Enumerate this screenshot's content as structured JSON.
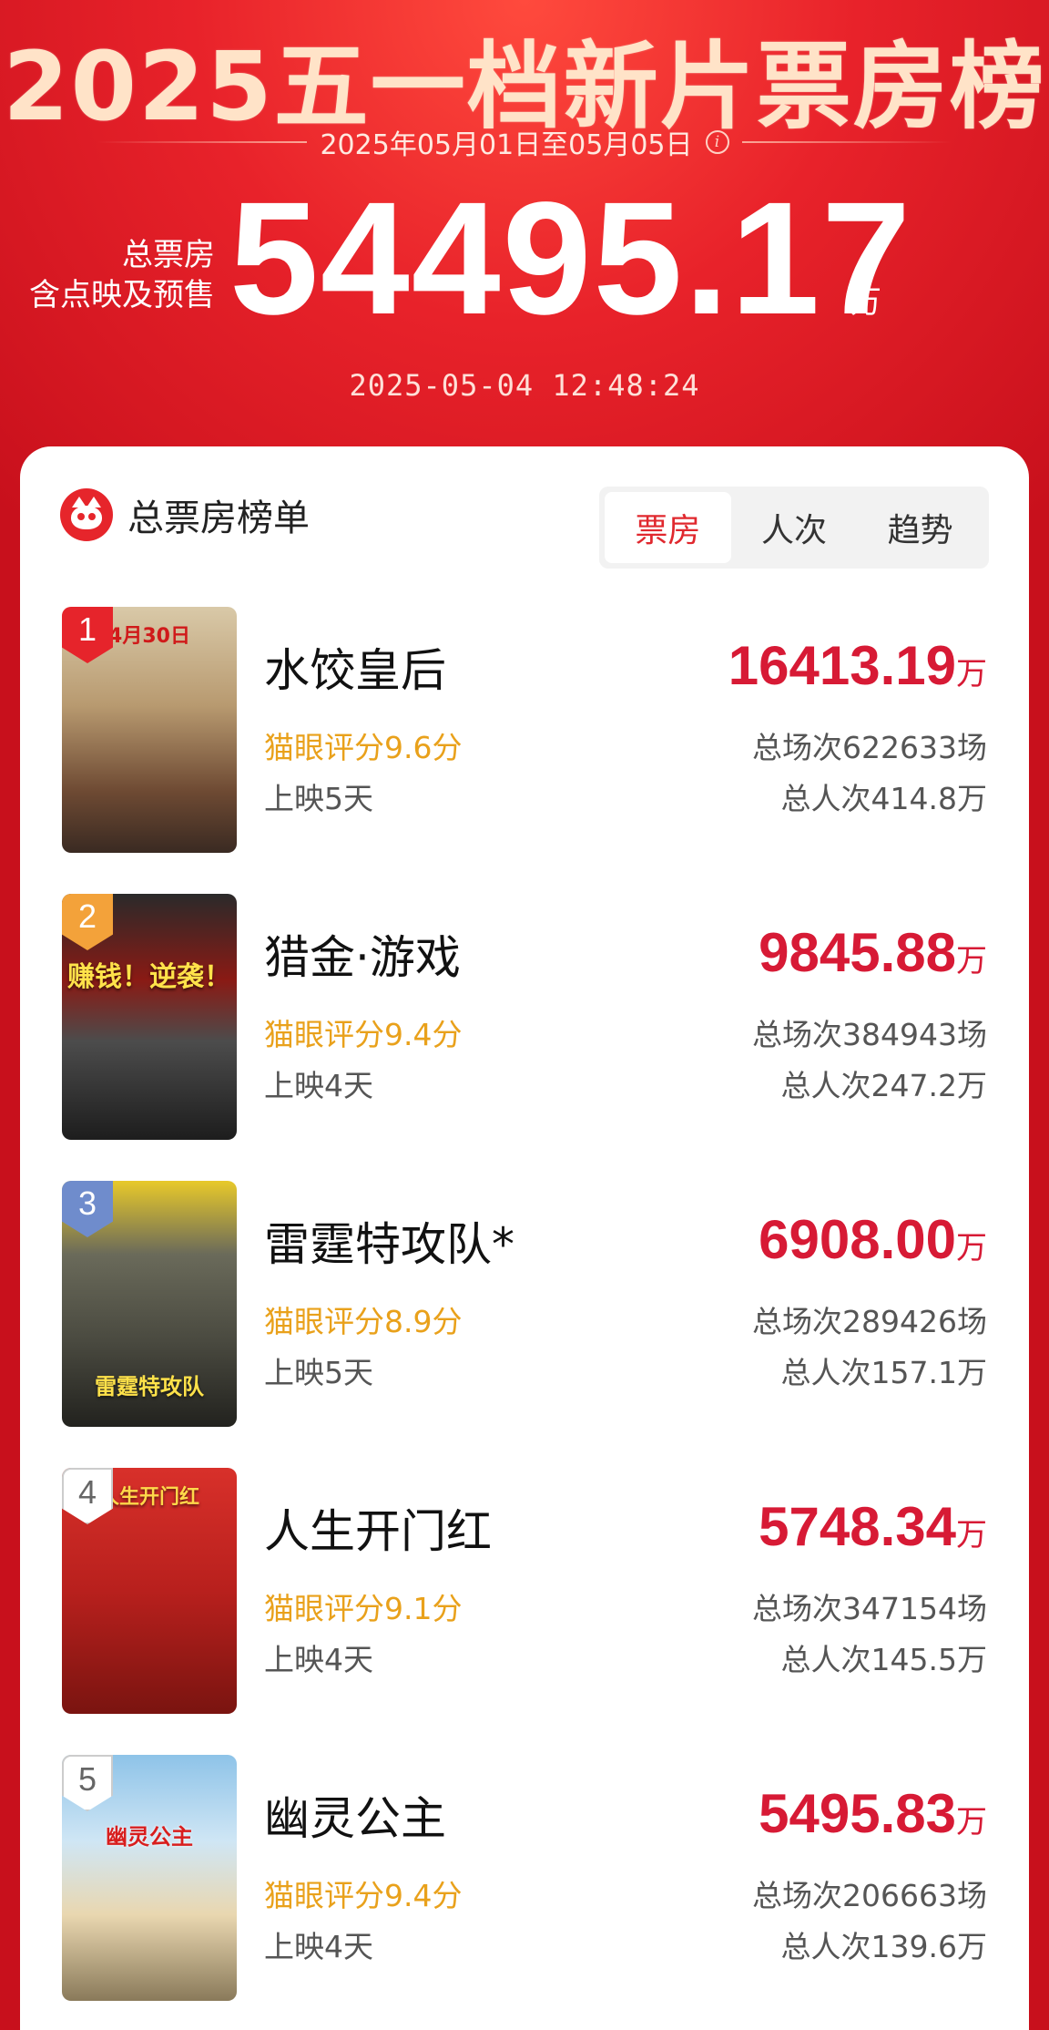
{
  "header": {
    "title": "2025五一档新片票房榜",
    "date_range": "2025年05月01日至05月05日",
    "total_label_line1": "总票房",
    "total_label_line2": "含点映及预售",
    "total_value": "54495.17",
    "total_unit": "万",
    "timestamp": "2025-05-04  12:48:24",
    "info_icon": "info-icon"
  },
  "card": {
    "title": "总票房榜单",
    "logo": "maoyan-cat-logo",
    "tabs": [
      {
        "label": "票房",
        "active": true
      },
      {
        "label": "人次",
        "active": false
      },
      {
        "label": "趋势",
        "active": false
      }
    ]
  },
  "colors": {
    "brand_red": "#e6252b",
    "gross_red": "#d71a35",
    "rating_orange": "#e9a11b",
    "badge_1": "#e6242b",
    "badge_2": "#f3a23a",
    "badge_3": "#6f8ccc",
    "badge_4": "#ffffff",
    "badge_5": "#ffffff"
  },
  "movies": [
    {
      "rank": "1",
      "name": "水饺皇后",
      "rating": "猫眼评分9.6分",
      "days": "上映5天",
      "gross": "16413.19",
      "unit": "万",
      "shows": "总场次622633场",
      "viewers": "总人次414.8万",
      "poster_text": "4月30日"
    },
    {
      "rank": "2",
      "name": "猎金·游戏",
      "rating": "猫眼评分9.4分",
      "days": "上映4天",
      "gross": "9845.88",
      "unit": "万",
      "shows": "总场次384943场",
      "viewers": "总人次247.2万",
      "poster_text": "赚钱！逆袭！"
    },
    {
      "rank": "3",
      "name": "雷霆特攻队*",
      "rating": "猫眼评分8.9分",
      "days": "上映5天",
      "gross": "6908.00",
      "unit": "万",
      "shows": "总场次289426场",
      "viewers": "总人次157.1万",
      "poster_text": "雷霆特攻队"
    },
    {
      "rank": "4",
      "name": "人生开门红",
      "rating": "猫眼评分9.1分",
      "days": "上映4天",
      "gross": "5748.34",
      "unit": "万",
      "shows": "总场次347154场",
      "viewers": "总人次145.5万",
      "poster_text": "人生开门红"
    },
    {
      "rank": "5",
      "name": "幽灵公主",
      "rating": "猫眼评分9.4分",
      "days": "上映4天",
      "gross": "5495.83",
      "unit": "万",
      "shows": "总场次206663场",
      "viewers": "总人次139.6万",
      "poster_text": "幽灵公主"
    }
  ]
}
